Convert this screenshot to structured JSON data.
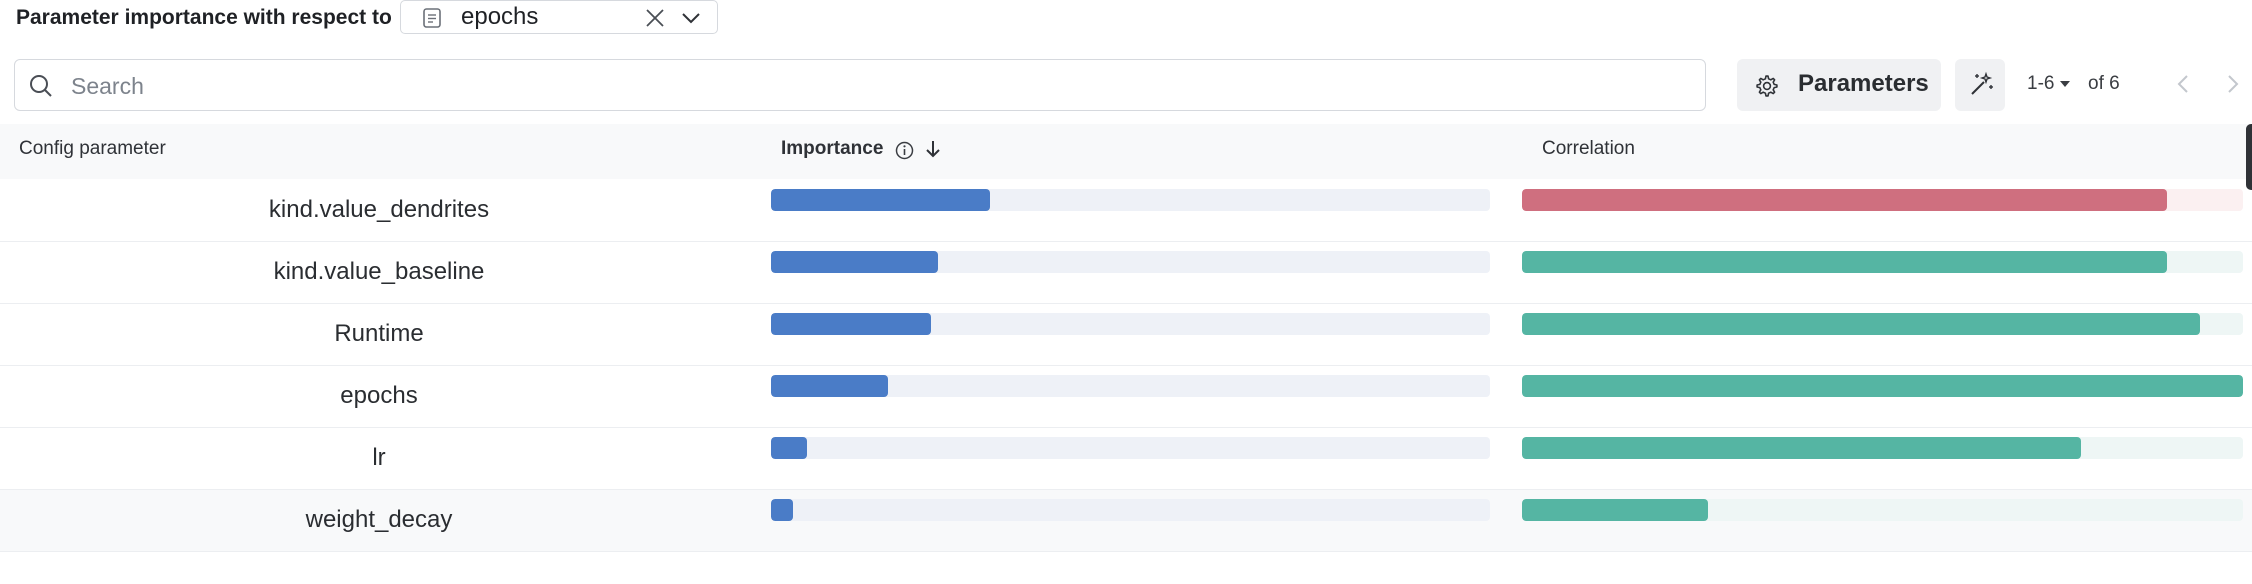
{
  "header": {
    "label": "Parameter importance with respect to"
  },
  "metric_select": {
    "value": "epochs",
    "icon": "document-icon"
  },
  "search": {
    "placeholder": "Search",
    "value": ""
  },
  "toolbar": {
    "parameters_label": "Parameters",
    "range_label": "1-6",
    "of_label": "of 6"
  },
  "table": {
    "columns": {
      "config": "Config parameter",
      "importance": "Importance",
      "correlation": "Correlation"
    },
    "sort": "importance-descending",
    "rows": [
      {
        "name": "kind.value_dendrites",
        "importance": 0.305,
        "correlation": 0.895,
        "sign": "negative"
      },
      {
        "name": "kind.value_baseline",
        "importance": 0.232,
        "correlation": 0.895,
        "sign": "positive"
      },
      {
        "name": "Runtime",
        "importance": 0.222,
        "correlation": 0.94,
        "sign": "positive"
      },
      {
        "name": "epochs",
        "importance": 0.163,
        "correlation": 1.0,
        "sign": "positive"
      },
      {
        "name": "lr",
        "importance": 0.05,
        "correlation": 0.775,
        "sign": "positive"
      },
      {
        "name": "weight_decay",
        "importance": 0.03,
        "correlation": 0.258,
        "sign": "positive"
      }
    ]
  },
  "colors": {
    "importance_fill": "#4a7cc7",
    "importance_track": "#eef1f7",
    "corr_positive": "#55b5a3",
    "corr_positive_track": "#eef6f5",
    "corr_negative": "#cf6f7f",
    "corr_negative_track": "#fbf0f1"
  }
}
